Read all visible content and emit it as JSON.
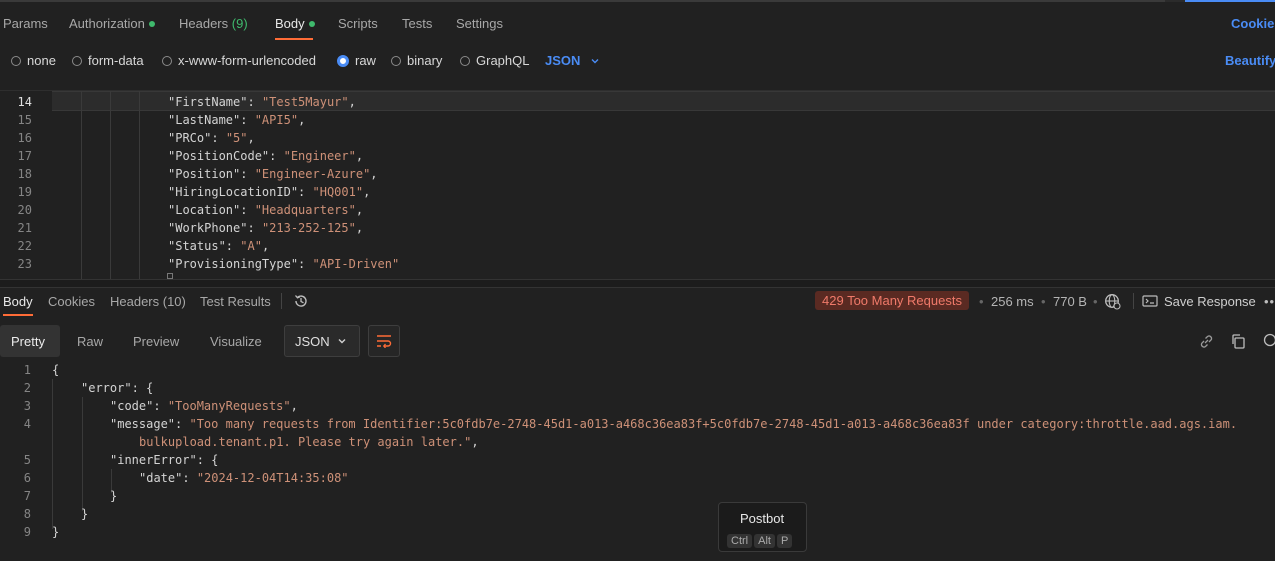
{
  "request_tabs": {
    "params": "Params",
    "authorization": "Authorization",
    "headers": "Headers",
    "headers_count": "(9)",
    "body": "Body",
    "scripts": "Scripts",
    "tests": "Tests",
    "settings": "Settings",
    "cookies": "Cookies"
  },
  "body_types": {
    "none": "none",
    "form_data": "form-data",
    "urlencoded": "x-www-form-urlencoded",
    "raw": "raw",
    "binary": "binary",
    "graphql": "GraphQL",
    "format": "JSON",
    "beautify": "Beautify"
  },
  "editor": {
    "lines": [
      {
        "n": "14",
        "key": "\"FirstName\"",
        "val": "\"Test5Mayur\"",
        "tail": ","
      },
      {
        "n": "15",
        "key": "\"LastName\"",
        "val": "\"API5\"",
        "tail": ","
      },
      {
        "n": "16",
        "key": "\"PRCo\"",
        "val": "\"5\"",
        "tail": ","
      },
      {
        "n": "17",
        "key": "\"PositionCode\"",
        "val": "\"Engineer\"",
        "tail": ","
      },
      {
        "n": "18",
        "key": "\"Position\"",
        "val": "\"Engineer-Azure\"",
        "tail": ","
      },
      {
        "n": "19",
        "key": "\"HiringLocationID\"",
        "val": "\"HQ001\"",
        "tail": ","
      },
      {
        "n": "20",
        "key": "\"Location\"",
        "val": "\"Headquarters\"",
        "tail": ","
      },
      {
        "n": "21",
        "key": "\"WorkPhone\"",
        "val": "\"213-252-125\"",
        "tail": ","
      },
      {
        "n": "22",
        "key": "\"Status\"",
        "val": "\"A\"",
        "tail": ","
      },
      {
        "n": "23",
        "key": "\"ProvisioningType\"",
        "val": "\"API-Driven\"",
        "tail": ""
      }
    ]
  },
  "response_tabs": {
    "body": "Body",
    "cookies": "Cookies",
    "headers": "Headers (10)",
    "test_results": "Test Results"
  },
  "response_meta": {
    "status": "429 Too Many Requests",
    "time": "256 ms",
    "size": "770 B",
    "save": "Save Response"
  },
  "view_modes": {
    "pretty": "Pretty",
    "raw": "Raw",
    "preview": "Preview",
    "visualize": "Visualize",
    "format": "JSON"
  },
  "response_body": {
    "lines": [
      {
        "n": "1",
        "parts": [
          [
            "p",
            "{"
          ]
        ]
      },
      {
        "n": "2",
        "parts": [
          [
            "k",
            "\"error\""
          ],
          [
            "p",
            ": {"
          ]
        ]
      },
      {
        "n": "3",
        "parts": [
          [
            "k",
            "\"code\""
          ],
          [
            "p",
            ": "
          ],
          [
            "s",
            "\"TooManyRequests\""
          ],
          [
            "p",
            ","
          ]
        ]
      },
      {
        "n": "4",
        "parts": [
          [
            "k",
            "\"message\""
          ],
          [
            "p",
            ": "
          ],
          [
            "s",
            "\"Too many requests from Identifier:5c0fdb7e-2748-45d1-a013-a468c36ea83f+5c0fdb7e-2748-45d1-a013-a468c36ea83f under category:throttle.aad.ags.iam."
          ]
        ]
      },
      {
        "n": "",
        "parts": [
          [
            "s",
            "bulkupload.tenant.p1. Please try again later.\""
          ],
          [
            "p",
            ","
          ]
        ]
      },
      {
        "n": "5",
        "parts": [
          [
            "k",
            "\"innerError\""
          ],
          [
            "p",
            ": {"
          ]
        ]
      },
      {
        "n": "6",
        "parts": [
          [
            "k",
            "\"date\""
          ],
          [
            "p",
            ": "
          ],
          [
            "s",
            "\"2024-12-04T14:35:08\""
          ]
        ]
      },
      {
        "n": "7",
        "parts": [
          [
            "p",
            "}"
          ]
        ]
      },
      {
        "n": "8",
        "parts": [
          [
            "p",
            "}"
          ]
        ]
      },
      {
        "n": "9",
        "parts": [
          [
            "p",
            "}"
          ]
        ]
      }
    ]
  },
  "postbot": {
    "title": "Postbot",
    "k1": "Ctrl",
    "k2": "Alt",
    "k3": "P"
  },
  "colors": {
    "accent": "#ff6c37",
    "blue": "#4a8cf5",
    "green": "#3fba6d",
    "error_bg": "#5a2a22",
    "error_fg": "#f07a6a"
  }
}
